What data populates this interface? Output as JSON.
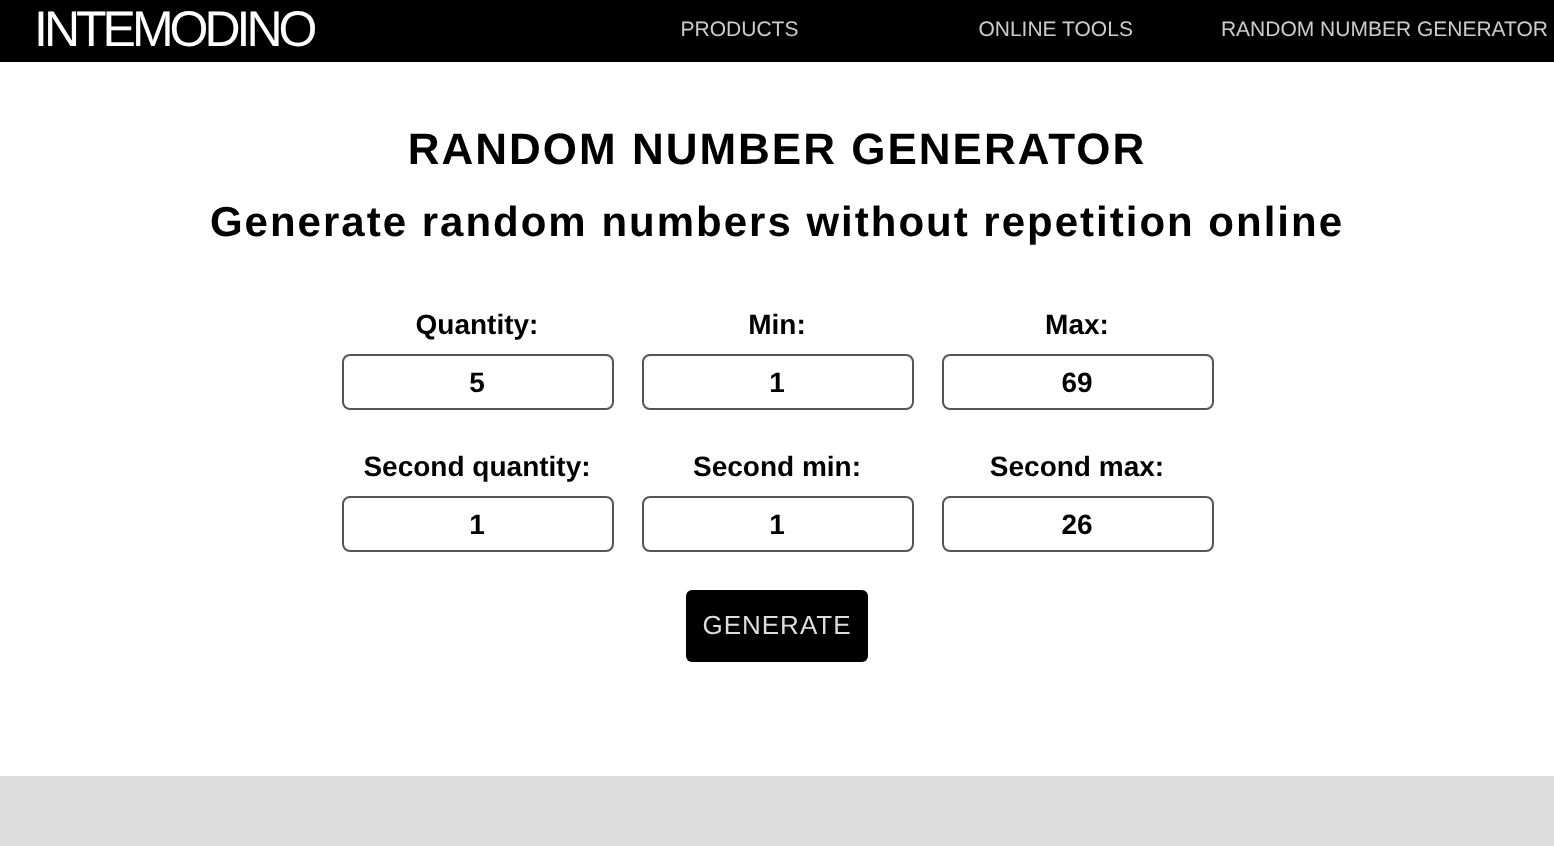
{
  "header": {
    "logo": "INTEMODINO",
    "nav": [
      {
        "label": "PRODUCTS"
      },
      {
        "label": "ONLINE TOOLS"
      },
      {
        "label": "RANDOM NUMBER GENERATOR"
      }
    ]
  },
  "title": "RANDOM NUMBER GENERATOR",
  "subtitle": "Generate random numbers without repetition online",
  "fields": [
    {
      "label": "Quantity:",
      "value": "5"
    },
    {
      "label": "Min:",
      "value": "1"
    },
    {
      "label": "Max:",
      "value": "69"
    },
    {
      "label": "Second quantity:",
      "value": "1"
    },
    {
      "label": "Second min:",
      "value": "1"
    },
    {
      "label": "Second max:",
      "value": "26"
    }
  ],
  "button": "GENERATE"
}
